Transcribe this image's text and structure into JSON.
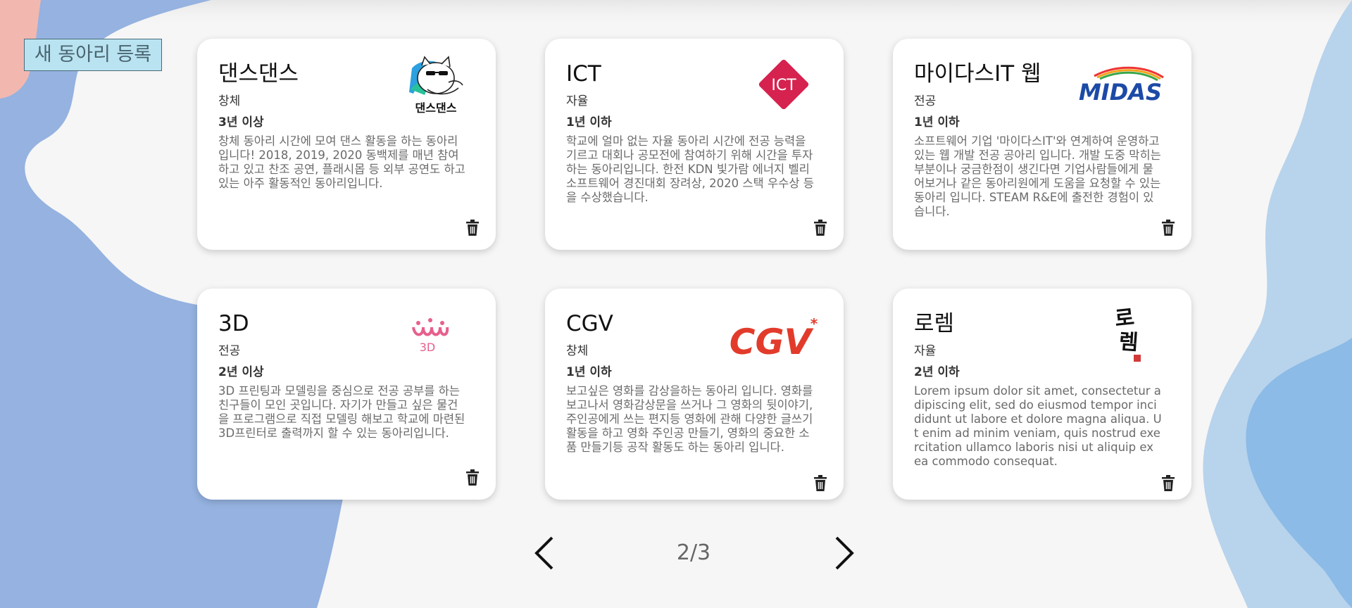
{
  "header": {
    "register_label": "새 동아리 등록"
  },
  "clubs": [
    {
      "title": "댄스댄스",
      "category": "창체",
      "years": "3년 이상",
      "description": "창체 동아리 시간에 모여 댄스 활동을 하는 동아리입니다! 2018, 2019, 2020 동백제를 매년 참여하고 있고 찬조 공연, 플래시몹 등 외부 공연도 하고 있는 아주 활동적인 동아리입니다.",
      "logo_text": "댄스댄스"
    },
    {
      "title": "ICT",
      "category": "자율",
      "years": "1년 이하",
      "description": "학교에 얼마 없는 자율 동아리 시간에 전공 능력을 기르고 대회나 공모전에 참여하기 위해 시간을 투자하는 동아리입니다. 한전 KDN 빛가람 에너지 벨리 소프트웨어 경진대회 장려상, 2020 스택 우수상 등을 수상했습니다.",
      "logo_text": "ICT"
    },
    {
      "title": "마이다스IT 웹",
      "category": "전공",
      "years": "1년 이하",
      "description": "소프트웨어 기업 '마이다스IT'와 연계하여 운영하고 있는 웹 개발 전공 공아리 입니다. 개발 도중 막히는 부분이나 궁금한점이 생긴다면 기업사람들에게 물어보거나 같은 동아리원에게 도움을 요청할 수 있는 동아리 입니다. STEAM R&E에 출전한 경험이 있습니다.",
      "logo_text": "MIDAS"
    },
    {
      "title": "3D",
      "category": "전공",
      "years": "2년 이상",
      "description": "3D 프린팅과 모델링을 중심으로 전공 공부를 하는 친구들이 모인 곳입니다. 자기가 만들고 싶은 물건을 프로그램으로 직접 모델링 해보고 학교에 마련된 3D프린터로 출력까지 할 수 있는 동아리입니다.",
      "logo_text": "3D"
    },
    {
      "title": "CGV",
      "category": "창체",
      "years": "1년 이하",
      "description": "보고싶은 영화를 감상을하는 동아리 입니다. 영화를 보고나서 영화감상문을 쓰거나 그 영화의 뒷이야기, 주인공에게 쓰는 편지등 영화에 관해 다양한 글쓰기 활동을 하고 영화 주인공 만들기, 영화의 중요한 소품 만들기등 공작 활동도 하는 동아리 입니다.",
      "logo_text": "CGV"
    },
    {
      "title": "로렘",
      "category": "자율",
      "years": "2년 이하",
      "description": "Lorem ipsum dolor sit amet, consectetur adipiscing elit, sed do eiusmod tempor incididunt ut labore et dolore magna aliqua. Ut enim ad minim veniam, quis nostrud exercitation ullamco laboris nisi ut aliquip ex ea commodo consequat.",
      "logo_text": "로렘"
    }
  ],
  "pagination": {
    "indicator": "2/3",
    "current_page": 2,
    "total_pages": 3
  },
  "icons": {
    "delete": "trash-icon",
    "prev": "chevron-left-icon",
    "next": "chevron-right-icon"
  },
  "colors": {
    "background": "#f6f6f6",
    "blob_left": "#95b2e0",
    "blob_pink": "#f2b8b0",
    "blob_right_light": "#b8d3ec",
    "blob_right_dark": "#8bbbe6",
    "register_bg": "#b9e3f1",
    "ict_red": "#d6224f",
    "cgv_red": "#e23b2b",
    "midas_blue": "#1c4aa6"
  }
}
